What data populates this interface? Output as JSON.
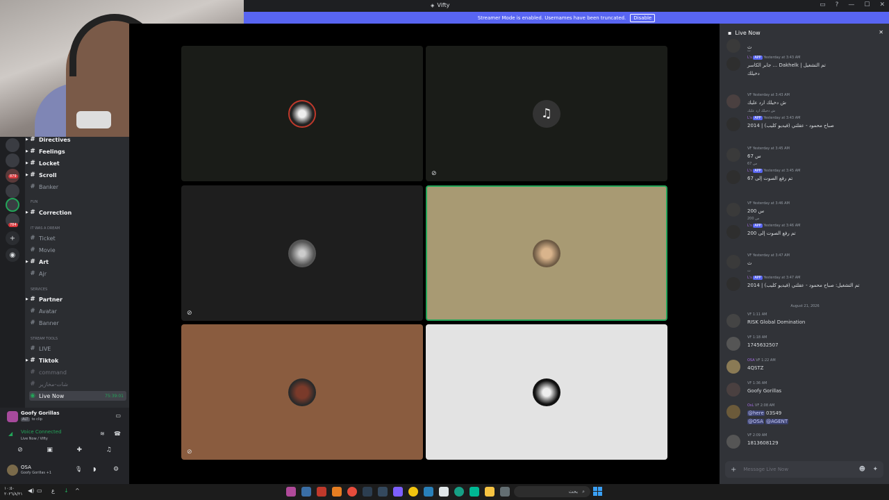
{
  "window": {
    "title": "Vifty"
  },
  "banner": {
    "text": "Streamer Mode is enabled. Usernames have been truncated.",
    "button": "Disable"
  },
  "servers": {
    "badges": [
      "879",
      "784"
    ]
  },
  "channels": {
    "items": [
      {
        "label": "Directives",
        "style": "bold"
      },
      {
        "label": "Feelings",
        "style": "bold"
      },
      {
        "label": "Locket",
        "style": "bold"
      },
      {
        "label": "Scroll",
        "style": "bold"
      },
      {
        "label": "Banker",
        "style": "muted"
      },
      {
        "label": "Correction",
        "style": "bold"
      },
      {
        "label": "Ticket",
        "style": "muted"
      },
      {
        "label": "Movie",
        "style": "muted"
      },
      {
        "label": "Art",
        "style": "bold"
      },
      {
        "label": "Ajr",
        "style": "muted"
      },
      {
        "label": "Partner",
        "style": "bold"
      },
      {
        "label": "Avatar",
        "style": "muted"
      },
      {
        "label": "Banner",
        "style": "muted"
      },
      {
        "label": "LIVE",
        "style": "muted"
      },
      {
        "label": "Tiktok",
        "style": "bold"
      },
      {
        "label": "command",
        "style": "muted"
      },
      {
        "label": "شات-مخازير",
        "style": "muted"
      },
      {
        "label": "Live Now",
        "style": "active"
      }
    ],
    "categories": [
      "FUN",
      "IT WAS A DREAM",
      "SERVICES",
      "STREAM TOOLS"
    ],
    "live_timer": "75:39:01"
  },
  "panel": {
    "activity_title": "Goofy Gorillas",
    "activity_sub": "to clip",
    "activity_key": "ALT",
    "voice_status": "Voice Connected",
    "voice_channel": "Live Now / Vifty",
    "user_name": "OSA",
    "user_status": "Goofy Gorillas +1"
  },
  "chat": {
    "title": "Live Now",
    "input_placeholder": "Message Live Now",
    "date_divider": "August 21, 2026",
    "messages": [
      {
        "meta_name": "",
        "tag": "",
        "time": "",
        "text": "ث"
      },
      {
        "meta_name": "L's",
        "tag": "APP",
        "time": "Yesterday at 3:43 AM",
        "reply": "ث",
        "text": "جابر الكاسر ... Dakhelk | تم التشغيل",
        "text2": "دخيلك"
      },
      {
        "meta_name": "",
        "tag": "VF",
        "time": "Yesterday at 3:43 AM",
        "text": "ش دخيلك ارد عليك"
      },
      {
        "meta_name": "L's",
        "tag": "APP",
        "time": "Yesterday at 3:43 AM",
        "reply": "ش دخيلك ارد عليك",
        "text": "صباح محمود - عقلتي (فيديو كليب) | 2014"
      },
      {
        "meta_name": "",
        "tag": "VF",
        "time": "Yesterday at 3:45 AM",
        "text": "س 67"
      },
      {
        "meta_name": "L's",
        "tag": "APP",
        "time": "Yesterday at 3:45 AM",
        "reply": "س 67",
        "text": "تم رفع الصوت إلى 67"
      },
      {
        "meta_name": "",
        "tag": "VF",
        "time": "Yesterday at 3:46 AM",
        "text": "س 200"
      },
      {
        "meta_name": "L's",
        "tag": "APP",
        "time": "Yesterday at 3:46 AM",
        "reply": "س 200",
        "text": "تم رفع الصوت إلى 200"
      },
      {
        "meta_name": "",
        "tag": "VF",
        "time": "Yesterday at 3:47 AM",
        "text": "ث"
      },
      {
        "meta_name": "L's",
        "tag": "APP",
        "time": "Yesterday at 3:47 AM",
        "reply": "ث",
        "text": "تم التشغيل: صباح محمود - عقلتي (فيديو كليب) | 2014"
      },
      {
        "meta_name": "",
        "tag": "VF",
        "time": "1:11 AM",
        "text": "RISK Global Domination"
      },
      {
        "meta_name": "",
        "tag": "VF",
        "time": "1:18 AM",
        "text": "1745632507"
      },
      {
        "meta_name": "OSA",
        "tag": "VF",
        "time": "1:22 AM",
        "text": "4QSTZ"
      },
      {
        "meta_name": "",
        "tag": "VF",
        "time": "1:36 AM",
        "text": "Goofy Gorillas"
      },
      {
        "meta_name": "OsL",
        "tag": "VF",
        "time": "2:08 AM",
        "text": "@here 03S49",
        "text2": "@OSA @AGENT"
      },
      {
        "meta_name": "",
        "tag": "VF",
        "time": "2:09 AM",
        "text": "1813608129"
      }
    ]
  },
  "taskbar": {
    "time": "١٠:٥٠",
    "date": "٢٠٢٦/٨/٢١",
    "lang": "ع",
    "search": "بحث"
  },
  "colors": {
    "accent": "#5865f2",
    "voice_green": "#23a559",
    "tile_brown": "#8a5c3f",
    "tile_tan": "#a89a73",
    "tile_light": "#e3e3e3"
  }
}
